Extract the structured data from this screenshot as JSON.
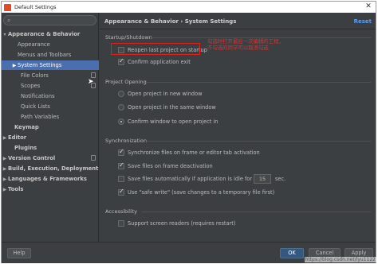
{
  "window": {
    "title": "Default Settings",
    "close_glyph": "✕"
  },
  "sidebar": {
    "items": [
      {
        "label": "Appearance & Behavior",
        "bold": true,
        "arrow": "▾"
      },
      {
        "label": "Appearance"
      },
      {
        "label": "Menus and Toolbars"
      },
      {
        "label": "System Settings",
        "selected": true,
        "arrow": "▶"
      },
      {
        "label": "File Colors"
      },
      {
        "label": "Scopes"
      },
      {
        "label": "Notifications"
      },
      {
        "label": "Quick Lists"
      },
      {
        "label": "Path Variables"
      },
      {
        "label": "Keymap",
        "bold": true
      },
      {
        "label": "Editor",
        "bold": true,
        "arrow": "▶"
      },
      {
        "label": "Plugins",
        "bold": true
      },
      {
        "label": "Version Control",
        "bold": true,
        "arrow": "▶"
      },
      {
        "label": "Build, Execution, Deployment",
        "bold": true,
        "arrow": "▶"
      },
      {
        "label": "Languages & Frameworks",
        "bold": true,
        "arrow": "▶"
      },
      {
        "label": "Tools",
        "bold": true,
        "arrow": "▶"
      }
    ]
  },
  "header": {
    "breadcrumb": "Appearance & Behavior  ›  System Settings",
    "reset": "Reset"
  },
  "startup": {
    "title": "Startup/Shutdown",
    "reopen_label": "Reopen last project on startup",
    "confirm_exit_label": "Confirm application exit"
  },
  "annotation": {
    "line1": "勾选时打开最后一次编辑的工程，",
    "line2": "不勾选的同学可以取消勾选"
  },
  "project_opening": {
    "title": "Project Opening",
    "new_window": "Open project in new window",
    "same_window": "Open project in the same window",
    "confirm_window": "Confirm window to open project in"
  },
  "synchronization": {
    "title": "Synchronization",
    "sync_files": "Synchronize files on frame or editor tab activation",
    "save_on_deactivation": "Save files on frame deactivation",
    "save_auto": "Save files automatically if application is idle for",
    "idle_seconds": "15",
    "seconds_unit": "sec.",
    "safe_write": "Use \"safe write\" (save changes to a temporary file first)"
  },
  "accessibility": {
    "title": "Accessibility",
    "screen_readers": "Support screen readers (requires restart)"
  },
  "footer": {
    "help": "Help",
    "ok": "OK",
    "cancel": "Cancel",
    "apply": "Apply"
  },
  "watermark": "https://blog.csdn.net/lyu1122",
  "colors": {
    "background": "#3c3f41",
    "selection": "#4b6eaf",
    "link": "#589df6",
    "annotation": "#e02020",
    "primary_button": "#365880"
  }
}
